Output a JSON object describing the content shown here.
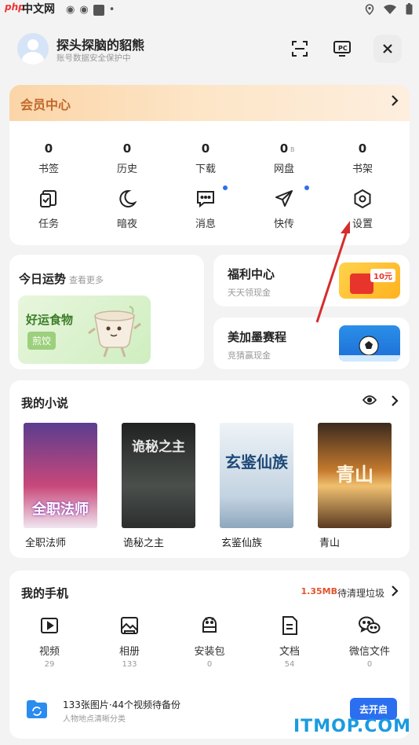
{
  "status_bar": {
    "watermark_php": "php",
    "watermark_cn": "中文网"
  },
  "header": {
    "username": "探头探脑的貂熊",
    "subtitle": "账号数据安全保护中",
    "icons": [
      "scan-icon",
      "pc-icon",
      "close-icon"
    ]
  },
  "member": {
    "title": "会员中心",
    "stats": [
      {
        "value": "0",
        "label": "书签"
      },
      {
        "value": "0",
        "label": "历史"
      },
      {
        "value": "0",
        "label": "下载"
      },
      {
        "value": "0",
        "label": "网盘",
        "unit": "B"
      },
      {
        "value": "0",
        "label": "书架"
      }
    ],
    "tools": [
      {
        "label": "任务",
        "icon": "task-icon"
      },
      {
        "label": "暗夜",
        "icon": "moon-icon"
      },
      {
        "label": "消息",
        "icon": "message-icon",
        "dot": true
      },
      {
        "label": "快传",
        "icon": "send-icon",
        "dot": true
      },
      {
        "label": "设置",
        "icon": "settings-icon"
      }
    ]
  },
  "fortune": {
    "title": "今日运势",
    "more": "查看更多",
    "food_title": "好运食物",
    "food_tag": "煎饺"
  },
  "welfare": {
    "title": "福利中心",
    "subtitle": "天天领现金",
    "badge": "10元"
  },
  "match": {
    "title": "美加墨赛程",
    "subtitle": "竞猜赢现金"
  },
  "novels": {
    "title": "我的小说",
    "books": [
      {
        "name": "全职法师",
        "cover_text": "全职法师",
        "cover_color": "#7a4fb0"
      },
      {
        "name": "诡秘之主",
        "cover_text": "诡秘之主",
        "cover_color": "#3c3f3e"
      },
      {
        "name": "玄鉴仙族",
        "cover_text": "玄鉴仙族",
        "cover_color": "#d6e2ec"
      },
      {
        "name": "青山",
        "cover_text": "青山",
        "cover_color": "#a06232"
      }
    ]
  },
  "phone": {
    "title": "我的手机",
    "size": "1.35MB",
    "clean_label": "待清理垃圾",
    "items": [
      {
        "label": "视频",
        "count": "29",
        "icon": "video-icon"
      },
      {
        "label": "相册",
        "count": "133",
        "icon": "album-icon"
      },
      {
        "label": "安装包",
        "count": "0",
        "icon": "android-icon"
      },
      {
        "label": "文档",
        "count": "54",
        "icon": "document-icon"
      },
      {
        "label": "微信文件",
        "count": "0",
        "icon": "wechat-icon"
      }
    ],
    "backup_main": "133张图片·44个视频待备份",
    "backup_sub": "人物地点清晰分类",
    "backup_button": "去开启"
  },
  "watermark": "ITMOP.COM",
  "colors": {
    "accent_blue": "#2b6ff0",
    "member_title": "#c1682a",
    "cleanup_size": "#e3532e",
    "annotation_arrow": "#d62c2c"
  }
}
